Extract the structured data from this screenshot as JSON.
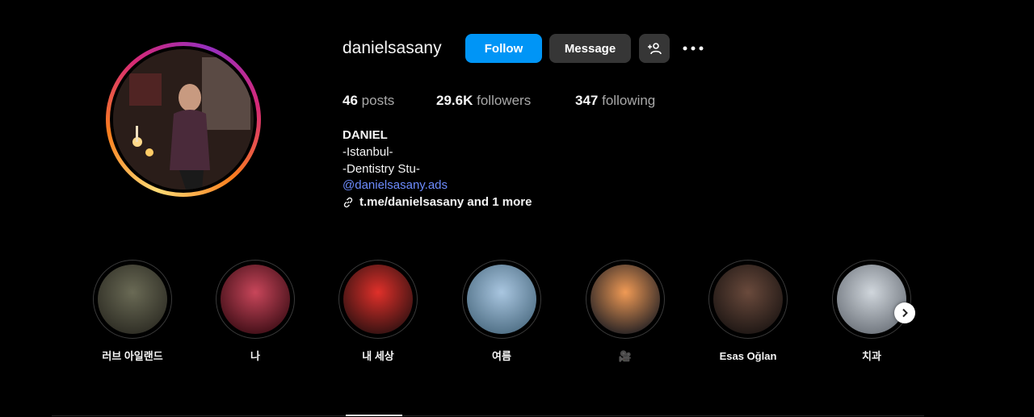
{
  "profile": {
    "username": "danielsasany",
    "follow_label": "Follow",
    "message_label": "Message",
    "add_user_icon": "person-add-icon",
    "more_icon": "more-horizontal-icon"
  },
  "stats": {
    "posts_count": "46",
    "posts_label": "posts",
    "followers_count": "29.6K",
    "followers_label": "followers",
    "following_count": "347",
    "following_label": "following"
  },
  "bio": {
    "name": "DANIEL",
    "line1": "-Istanbul-",
    "line2": "-Dentistry Stu-",
    "mention": "@danielsasany.ads",
    "link": "t.me/danielsasany and 1 more",
    "link_icon": "link-icon"
  },
  "highlights": [
    {
      "label": "러브 아일랜드",
      "colors": [
        "#6a6a55",
        "#2b2a22"
      ]
    },
    {
      "label": "나",
      "colors": [
        "#c8465a",
        "#3a0c14"
      ]
    },
    {
      "label": "내 세상",
      "colors": [
        "#e0302a",
        "#2a1010"
      ]
    },
    {
      "label": "여름",
      "colors": [
        "#a9c6e0",
        "#4a6a80"
      ]
    },
    {
      "label": "🎥",
      "colors": [
        "#f09a55",
        "#1c1c22"
      ]
    },
    {
      "label": "Esas Oğlan",
      "colors": [
        "#6a4a3c",
        "#1a1412"
      ]
    },
    {
      "label": "치과",
      "colors": [
        "#d0d6dc",
        "#6a7078"
      ]
    }
  ],
  "colors": {
    "accent": "#0095f6",
    "button_secondary": "#363636",
    "link": "#6d8cff"
  }
}
